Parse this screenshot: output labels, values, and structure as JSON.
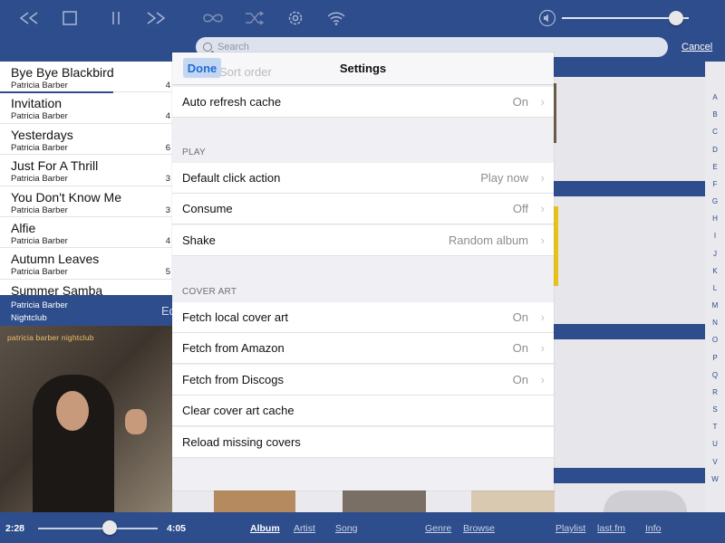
{
  "toolbar": {
    "icons": [
      "rewind-icon",
      "stop-icon",
      "pause-icon",
      "fast-forward-icon",
      "repeat-icon",
      "shuffle-icon",
      "gear-icon",
      "wifi-icon",
      "speaker-icon"
    ],
    "volume_fraction": 0.9
  },
  "search": {
    "placeholder": "Search",
    "cancel_label": "Cancel"
  },
  "playlist": {
    "items": [
      {
        "title": "Bye Bye Blackbird",
        "artist": "Patricia Barber",
        "num": "4"
      },
      {
        "title": "Invitation",
        "artist": "Patricia Barber",
        "num": "4"
      },
      {
        "title": "Yesterdays",
        "artist": "Patricia Barber",
        "num": "6"
      },
      {
        "title": "Just For A Thrill",
        "artist": "Patricia Barber",
        "num": "3"
      },
      {
        "title": "You Don't Know Me",
        "artist": "Patricia Barber",
        "num": "3"
      },
      {
        "title": "Alfie",
        "artist": "Patricia Barber",
        "num": "4"
      },
      {
        "title": "Autumn Leaves",
        "artist": "Patricia Barber",
        "num": "5"
      },
      {
        "title": "Summer Samba",
        "artist": "",
        "num": ""
      }
    ]
  },
  "now_playing": {
    "artist": "Patricia Barber",
    "album": "Nightclub",
    "extra": "Ed",
    "cover_text": "patricia barber nightclub"
  },
  "settings": {
    "title": "Settings",
    "done_label": "Done",
    "ghost_label": "Sort order",
    "rows_top": [
      {
        "label": "Auto refresh cache",
        "value": "On",
        "chevron": "›"
      }
    ],
    "section_play": "PLAY",
    "rows_play": [
      {
        "label": "Default click action",
        "value": "Play now",
        "chevron": "›"
      },
      {
        "label": "Consume",
        "value": "Off",
        "chevron": "›"
      },
      {
        "label": "Shake",
        "value": "Random album",
        "chevron": "›"
      }
    ],
    "section_cover": "COVER ART",
    "rows_cover": [
      {
        "label": "Fetch local cover art",
        "value": "On",
        "chevron": "›"
      },
      {
        "label": "Fetch from Amazon",
        "value": "On",
        "chevron": "›"
      },
      {
        "label": "Fetch from Discogs",
        "value": "On",
        "chevron": "›"
      },
      {
        "label": "Clear cover art cache",
        "value": "",
        "chevron": ""
      },
      {
        "label": "Reload missing covers",
        "value": "",
        "chevron": ""
      }
    ]
  },
  "alphabet": [
    "A",
    "B",
    "C",
    "D",
    "E",
    "F",
    "G",
    "H",
    "I",
    "J",
    "K",
    "L",
    "M",
    "N",
    "O",
    "P",
    "Q",
    "R",
    "S",
    "T",
    "U",
    "V",
    "W"
  ],
  "bottom": {
    "elapsed": "2:28",
    "total": "4:05",
    "progress_fraction": 0.6,
    "nav": [
      "Album",
      "Artist",
      "Song",
      "Genre",
      "Browse",
      "Playlist",
      "last.fm",
      "Info"
    ],
    "active_nav": "Album"
  },
  "colors": {
    "accent": "#2e4d8c",
    "link": "#1f6cd6"
  }
}
